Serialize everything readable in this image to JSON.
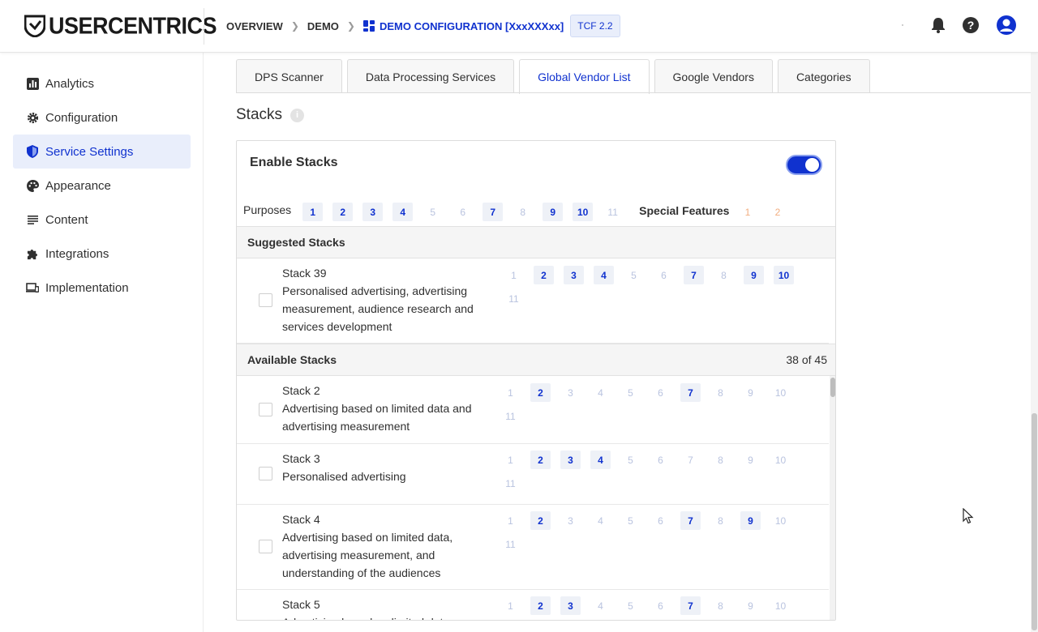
{
  "brand": {
    "logo_text": "USERCENTRICS"
  },
  "breadcrumb": {
    "items": [
      "OVERVIEW",
      "DEMO"
    ],
    "current": "DEMO CONFIGURATION [XxxXXXxx]",
    "badge": "TCF 2.2"
  },
  "sidebar": {
    "items": [
      {
        "label": "Analytics",
        "icon": "bar-chart-icon"
      },
      {
        "label": "Configuration",
        "icon": "gear-icon"
      },
      {
        "label": "Service Settings",
        "icon": "shield-icon",
        "active": true
      },
      {
        "label": "Appearance",
        "icon": "palette-icon"
      },
      {
        "label": "Content",
        "icon": "list-icon"
      },
      {
        "label": "Integrations",
        "icon": "puzzle-icon"
      },
      {
        "label": "Implementation",
        "icon": "devices-icon"
      }
    ]
  },
  "tabs": [
    {
      "label": "DPS Scanner"
    },
    {
      "label": "Data Processing Services"
    },
    {
      "label": "Global Vendor List",
      "active": true
    },
    {
      "label": "Google Vendors"
    },
    {
      "label": "Categories"
    }
  ],
  "stacks": {
    "title": "Stacks",
    "info_icon": "i",
    "enable_label": "Enable Stacks",
    "enabled": true,
    "purposes_label": "Purposes",
    "purposes": [
      {
        "n": "1",
        "on": true
      },
      {
        "n": "2",
        "on": true
      },
      {
        "n": "3",
        "on": true
      },
      {
        "n": "4",
        "on": true
      },
      {
        "n": "5",
        "on": false
      },
      {
        "n": "6",
        "on": false
      },
      {
        "n": "7",
        "on": true
      },
      {
        "n": "8",
        "on": false
      },
      {
        "n": "9",
        "on": true
      },
      {
        "n": "10",
        "on": true
      },
      {
        "n": "11",
        "on": false
      }
    ],
    "special_features_label": "Special Features",
    "special_features": [
      "1",
      "2"
    ],
    "suggested_label": "Suggested Stacks",
    "available_label": "Available Stacks",
    "available_count": "38 of 45",
    "suggested": [
      {
        "name": "Stack 39",
        "desc": "Personalised advertising, advertising measurement, audience research and services development",
        "on": [
          "2",
          "3",
          "4",
          "7",
          "9",
          "10"
        ]
      }
    ],
    "available": [
      {
        "name": "Stack 2",
        "desc": "Advertising based on limited data and advertising measurement",
        "on": [
          "2",
          "7"
        ]
      },
      {
        "name": "Stack 3",
        "desc": "Personalised advertising",
        "on": [
          "2",
          "3",
          "4"
        ]
      },
      {
        "name": "Stack 4",
        "desc": "Advertising based on limited data, advertising measurement, and understanding of the audiences",
        "on": [
          "2",
          "7",
          "9"
        ]
      },
      {
        "name": "Stack 5",
        "desc": "Advertising based on limited data,",
        "on": [
          "2",
          "3",
          "7"
        ]
      }
    ]
  },
  "colors": {
    "accent": "#1032cf",
    "accent_bg": "#e9eefb",
    "special_feature": "#f2ae80"
  }
}
